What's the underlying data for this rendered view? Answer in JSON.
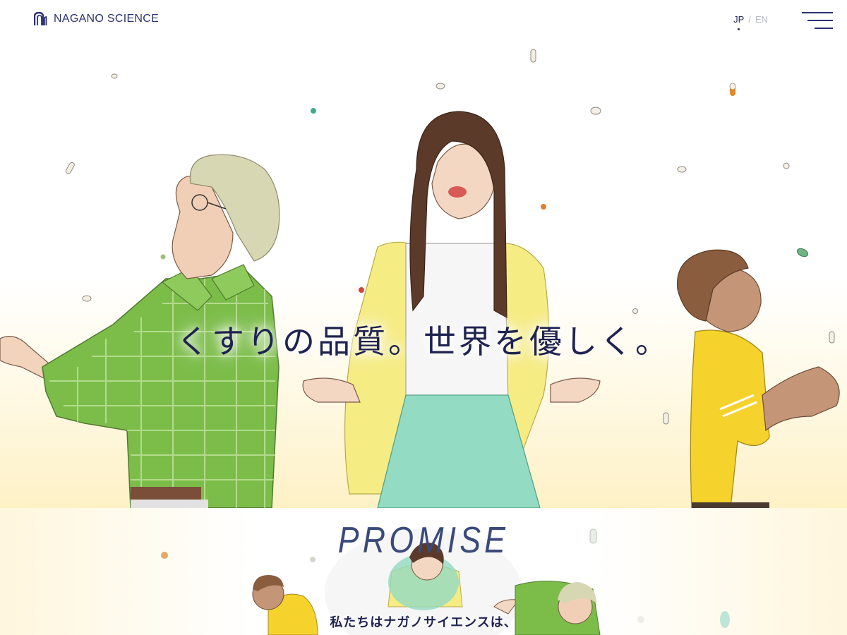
{
  "header": {
    "logo_text": "NAGANO SCIENCE",
    "logo_icon": "arch-logo-icon",
    "lang": {
      "jp": "JP",
      "sep": "/",
      "en": "EN",
      "active": "JP"
    },
    "menu_icon": "hamburger-menu-icon"
  },
  "hero": {
    "title": "くすりの品質。世界を優しく。",
    "illustration": "people-catching-falling-pills-illustration"
  },
  "promise": {
    "heading": "PROMISE",
    "lead": "私たちはナガノサイエンスは、",
    "illustration": "people-from-above-illustration"
  },
  "colors": {
    "brand_navy": "#2c3272",
    "text_dark": "#1f2350",
    "promise_heading": "#3a4a7a",
    "hero_gradient_bottom": "#fdf1c5",
    "shirt_green": "#7cbd4a",
    "cardigan_yellow": "#f6ec84",
    "skirt_mint": "#93dbc2",
    "shirt_yellow": "#f6d22d"
  }
}
